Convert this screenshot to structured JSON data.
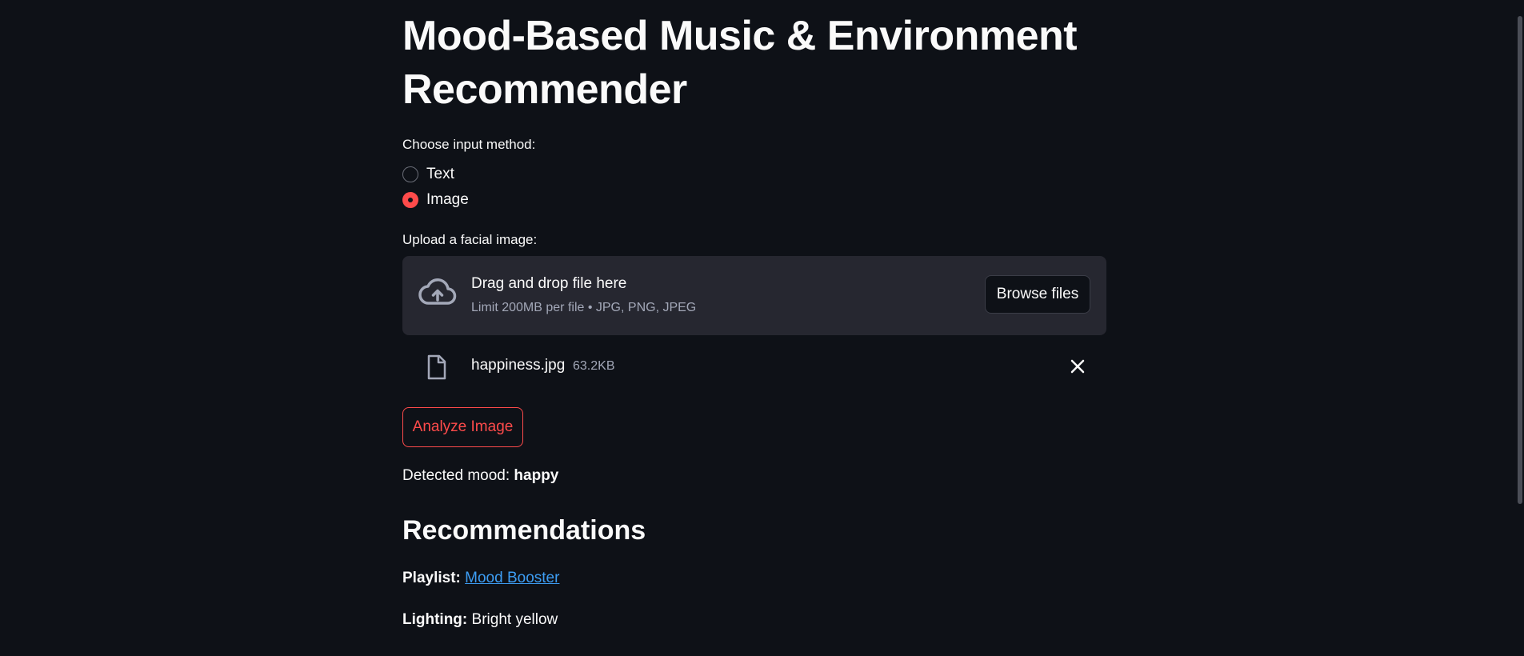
{
  "page": {
    "title": "Mood-Based Music & Environment Recommender"
  },
  "input_method": {
    "label": "Choose input method:",
    "options": [
      {
        "label": "Text",
        "selected": false
      },
      {
        "label": "Image",
        "selected": true
      }
    ]
  },
  "uploader": {
    "label": "Upload a facial image:",
    "drop_title": "Drag and drop file here",
    "drop_subtitle": "Limit 200MB per file • JPG, PNG, JPEG",
    "browse_label": "Browse files",
    "file": {
      "name": "happiness.jpg",
      "size": "63.2KB"
    }
  },
  "actions": {
    "analyze_label": "Analyze Image"
  },
  "result": {
    "mood_prefix": "Detected mood: ",
    "mood_value": "happy"
  },
  "recommendations": {
    "heading": "Recommendations",
    "playlist_label": "Playlist:",
    "playlist_value": "Mood Booster",
    "lighting_label": "Lighting:",
    "lighting_value": "Bright yellow"
  },
  "colors": {
    "background": "#0e1117",
    "accent": "#ff4b4b",
    "link": "#3d9df3",
    "panel": "#262730"
  },
  "icons": [
    "cloud-upload-icon",
    "file-icon",
    "close-icon"
  ]
}
